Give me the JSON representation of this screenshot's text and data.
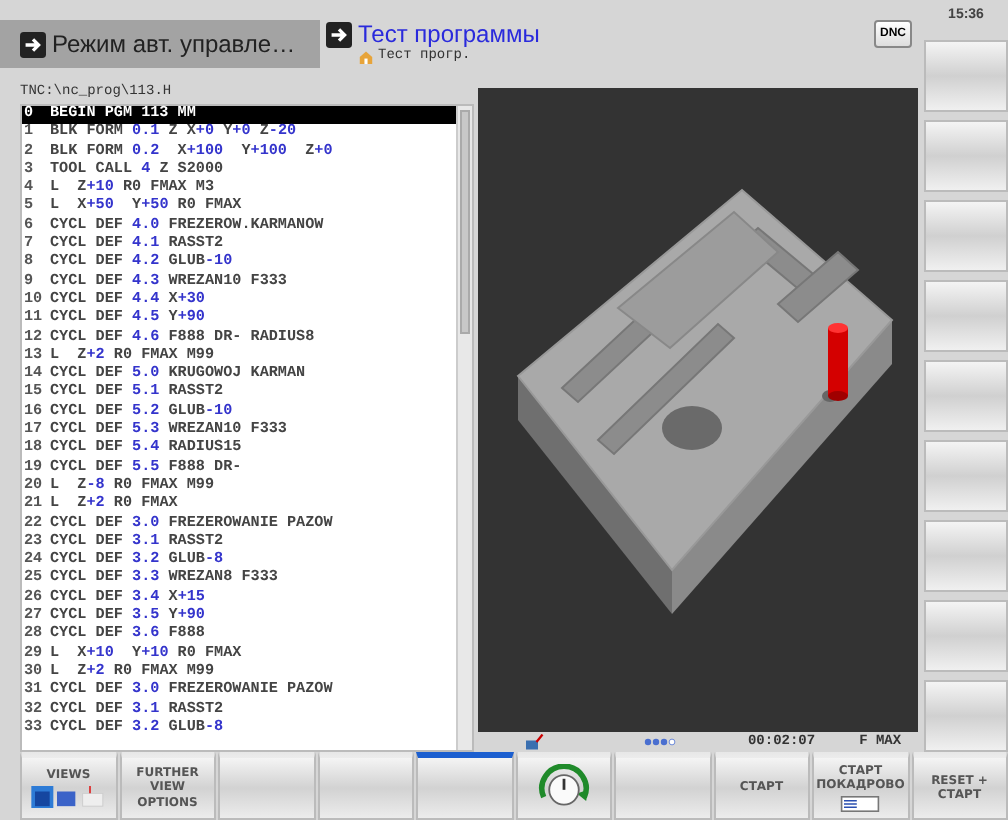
{
  "header": {
    "mode": "Режим авт. управле…",
    "title": "Тест программы",
    "subtitle": "Тест прогр.",
    "dnc": "DNC",
    "clock": "15:36"
  },
  "program": {
    "path": "TNC:\\nc_prog\\113.H",
    "lines": [
      {
        "number": "0",
        "segments": [
          "BEGIN PGM 113 MM"
        ],
        "selected": true
      },
      {
        "number": "1",
        "segments": [
          "BLK FORM ",
          "0.1",
          " Z X",
          "+0",
          " Y",
          "+0",
          " Z",
          "-20"
        ],
        "selected": false
      },
      {
        "number": "2",
        "segments": [
          "BLK FORM ",
          "0.2",
          "  X",
          "+100",
          "  Y",
          "+100",
          "  Z",
          "+0"
        ],
        "selected": false
      },
      {
        "number": "3",
        "segments": [
          "TOOL CALL ",
          "4",
          " Z S2000"
        ],
        "selected": false
      },
      {
        "number": "4",
        "segments": [
          "L  Z",
          "+10",
          " R0 FMAX M3"
        ],
        "selected": false
      },
      {
        "number": "5",
        "segments": [
          "L  X",
          "+50",
          "  Y",
          "+50",
          " R0 FMAX"
        ],
        "selected": false
      },
      {
        "number": "6",
        "segments": [
          "CYCL DEF ",
          "4.0",
          " FREZEROW.KARMANOW"
        ],
        "selected": false
      },
      {
        "number": "7",
        "segments": [
          "CYCL DEF ",
          "4.1",
          " RASST2"
        ],
        "selected": false
      },
      {
        "number": "8",
        "segments": [
          "CYCL DEF ",
          "4.2",
          " GLUB",
          "-10"
        ],
        "selected": false
      },
      {
        "number": "9",
        "segments": [
          "CYCL DEF ",
          "4.3",
          " WREZAN10 F333"
        ],
        "selected": false
      },
      {
        "number": "10",
        "segments": [
          "CYCL DEF ",
          "4.4",
          " X",
          "+30"
        ],
        "selected": false
      },
      {
        "number": "11",
        "segments": [
          "CYCL DEF ",
          "4.5",
          " Y",
          "+90"
        ],
        "selected": false
      },
      {
        "number": "12",
        "segments": [
          "CYCL DEF ",
          "4.6",
          " F888 DR- RADIUS8"
        ],
        "selected": false
      },
      {
        "number": "13",
        "segments": [
          "L  Z",
          "+2",
          " R0 FMAX M99"
        ],
        "selected": false
      },
      {
        "number": "14",
        "segments": [
          "CYCL DEF ",
          "5.0",
          " KRUGOWOJ KARMAN"
        ],
        "selected": false
      },
      {
        "number": "15",
        "segments": [
          "CYCL DEF ",
          "5.1",
          " RASST2"
        ],
        "selected": false
      },
      {
        "number": "16",
        "segments": [
          "CYCL DEF ",
          "5.2",
          " GLUB",
          "-10"
        ],
        "selected": false
      },
      {
        "number": "17",
        "segments": [
          "CYCL DEF ",
          "5.3",
          " WREZAN10 F333"
        ],
        "selected": false
      },
      {
        "number": "18",
        "segments": [
          "CYCL DEF ",
          "5.4",
          " RADIUS15"
        ],
        "selected": false
      },
      {
        "number": "19",
        "segments": [
          "CYCL DEF ",
          "5.5",
          " F888 DR-"
        ],
        "selected": false
      },
      {
        "number": "20",
        "segments": [
          "L  Z",
          "-8",
          " R0 FMAX M99"
        ],
        "selected": false
      },
      {
        "number": "21",
        "segments": [
          "L  Z",
          "+2",
          " R0 FMAX"
        ],
        "selected": false
      },
      {
        "number": "22",
        "segments": [
          "CYCL DEF ",
          "3.0",
          " FREZEROWANIE PAZOW"
        ],
        "selected": false
      },
      {
        "number": "23",
        "segments": [
          "CYCL DEF ",
          "3.1",
          " RASST2"
        ],
        "selected": false
      },
      {
        "number": "24",
        "segments": [
          "CYCL DEF ",
          "3.2",
          " GLUB",
          "-8"
        ],
        "selected": false
      },
      {
        "number": "25",
        "segments": [
          "CYCL DEF ",
          "3.3",
          " WREZAN8 F333"
        ],
        "selected": false
      },
      {
        "number": "26",
        "segments": [
          "CYCL DEF ",
          "3.4",
          " X",
          "+15"
        ],
        "selected": false
      },
      {
        "number": "27",
        "segments": [
          "CYCL DEF ",
          "3.5",
          " Y",
          "+90"
        ],
        "selected": false
      },
      {
        "number": "28",
        "segments": [
          "CYCL DEF ",
          "3.6",
          " F888"
        ],
        "selected": false
      },
      {
        "number": "29",
        "segments": [
          "L  X",
          "+10",
          "  Y",
          "+10",
          " R0 FMAX"
        ],
        "selected": false
      },
      {
        "number": "30",
        "segments": [
          "L  Z",
          "+2",
          " R0 FMAX M99"
        ],
        "selected": false
      },
      {
        "number": "31",
        "segments": [
          "CYCL DEF ",
          "3.0",
          " FREZEROWANIE PAZOW"
        ],
        "selected": false
      },
      {
        "number": "32",
        "segments": [
          "CYCL DEF ",
          "3.1",
          " RASST2"
        ],
        "selected": false
      },
      {
        "number": "33",
        "segments": [
          "CYCL DEF ",
          "3.2",
          " GLUB",
          "-8"
        ],
        "selected": false
      }
    ]
  },
  "status": {
    "time": "00:02:07",
    "feed": "F MAX"
  },
  "softkeys": [
    {
      "kind": "views",
      "label": "VIEWS",
      "active": false
    },
    {
      "kind": "text",
      "label": "FURTHER VIEW OPTIONS",
      "active": false
    },
    {
      "kind": "empty",
      "active": false
    },
    {
      "kind": "empty",
      "active": false
    },
    {
      "kind": "empty",
      "active": true
    },
    {
      "kind": "dial",
      "active": false
    },
    {
      "kind": "empty",
      "active": false
    },
    {
      "kind": "text",
      "label": "СТАРТ",
      "active": false
    },
    {
      "kind": "single",
      "label": "СТАРТ ПОКАДРОВО",
      "active": false
    },
    {
      "kind": "text",
      "label": "RESET + СТАРТ",
      "active": false
    }
  ]
}
